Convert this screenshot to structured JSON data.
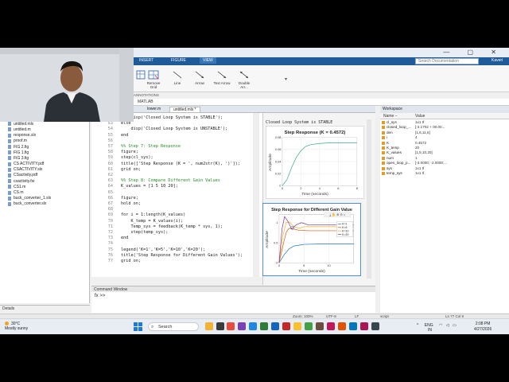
{
  "ribbon": {
    "tabs": [
      "INSERT",
      "FIGURE",
      "VIEW"
    ],
    "active_tab": "VIEW",
    "search_placeholder": "Search Documentation",
    "user": "Kaveri",
    "buttons": [
      "Remove Grid",
      "Line",
      "Arrow",
      "Text Arrow",
      "Double Arr..."
    ],
    "section_label": "ANNOTATIONS"
  },
  "address": "MATLAB",
  "files": {
    "items": [
      "untitled2.m",
      "untitled.mlx",
      "untitled.m",
      "response.slx",
      "proof.m",
      "FIG 2.fig",
      "FIG 1.fig",
      "FIG 3.fig",
      "CS ACTIVITY.pdf",
      "CSACTIVITY.slx",
      "CSactivity.pdf",
      "csactivity.fw",
      "CS1.m",
      "CS.m",
      "buck_converter_1.slx",
      "buck_converter.slx"
    ],
    "details_label": "Details"
  },
  "editor": {
    "tabs": [
      "lower.m",
      "untitled.mlx *"
    ],
    "lines": [
      {
        "n": "52",
        "t": "    disp('Closed Loop System is STABLE');",
        "c": false
      },
      {
        "n": "53",
        "t": "else",
        "c": false
      },
      {
        "n": "54",
        "t": "    disp('Closed Loop System is UNSTABLE');",
        "c": false
      },
      {
        "n": "55",
        "t": "end",
        "c": false
      },
      {
        "n": "56",
        "t": "",
        "c": false
      },
      {
        "n": "57",
        "t": "%% Step 7: Step Response",
        "c": true
      },
      {
        "n": "58",
        "t": "figure;",
        "c": false
      },
      {
        "n": "59",
        "t": "step(cl_sys);",
        "c": false
      },
      {
        "n": "60",
        "t": "title(['Step Response (K = ', num2str(K), ')']);",
        "c": false
      },
      {
        "n": "61",
        "t": "grid on;",
        "c": false
      },
      {
        "n": "62",
        "t": "",
        "c": false
      },
      {
        "n": "63",
        "t": "%% Step 8: Compare Different Gain Values",
        "c": true
      },
      {
        "n": "64",
        "t": "K_values = [1 5 10 20];",
        "c": false
      },
      {
        "n": "65",
        "t": "",
        "c": false
      },
      {
        "n": "66",
        "t": "figure;",
        "c": false
      },
      {
        "n": "67",
        "t": "hold on;",
        "c": false
      },
      {
        "n": "68",
        "t": "",
        "c": false
      },
      {
        "n": "69",
        "t": "for i = 1:length(K_values)",
        "c": false
      },
      {
        "n": "70",
        "t": "    K_temp = K_values(i);",
        "c": false
      },
      {
        "n": "71",
        "t": "    Temp_sys = feedback(K_temp * sys, 1);",
        "c": false
      },
      {
        "n": "72",
        "t": "    step(temp_sys);",
        "c": false
      },
      {
        "n": "73",
        "t": "end",
        "c": false
      },
      {
        "n": "74",
        "t": "",
        "c": false
      },
      {
        "n": "75",
        "t": "legend('K=1','K=5','K=10','K=20');",
        "c": false
      },
      {
        "n": "76",
        "t": "title('Step Response for Different Gain Values');",
        "c": false
      },
      {
        "n": "77",
        "t": "grid on;",
        "c": false
      }
    ]
  },
  "figures": {
    "output_text": "Closed Loop System is STABLE",
    "fig1": {
      "title": "Step Response (K = 0.4572)",
      "xlabel": "Time (seconds)",
      "ylabel": "Amplitude"
    },
    "fig2": {
      "title": "Step Response for Different Gain Value",
      "xlabel": "Time (seconds)",
      "ylabel": "Amplitude",
      "legend": [
        "K=1",
        "K=5",
        "K=10",
        "K=20"
      ]
    }
  },
  "chart_data": [
    {
      "type": "line",
      "title": "Step Response (K = 0.4572)",
      "xlabel": "Time (seconds)",
      "ylabel": "Amplitude",
      "xlim": [
        0,
        8
      ],
      "ylim": [
        0,
        0.08
      ],
      "xticks": [
        0,
        2,
        4,
        6,
        8
      ],
      "yticks": [
        0,
        0.02,
        0.04,
        0.06,
        0.08
      ],
      "series": [
        {
          "color": "#3aa88a",
          "x": [
            0,
            0.5,
            1,
            1.5,
            2,
            2.5,
            3,
            4,
            5,
            6,
            7,
            8
          ],
          "y": [
            0,
            0.01,
            0.03,
            0.047,
            0.058,
            0.065,
            0.068,
            0.07,
            0.071,
            0.071,
            0.071,
            0.071
          ]
        }
      ],
      "grid": true
    },
    {
      "type": "line",
      "title": "Step Response for Different Gain Value",
      "xlabel": "Time (seconds)",
      "ylabel": "Amplitude",
      "xlim": [
        0,
        15
      ],
      "ylim": [
        0,
        1.2
      ],
      "xticks": [
        0,
        5,
        10
      ],
      "yticks": [
        0,
        0.5,
        1
      ],
      "legend_position": "top-right",
      "series": [
        {
          "name": "K=1",
          "color": "#1f77b4",
          "x": [
            0,
            1,
            2,
            3,
            5,
            8,
            12,
            15
          ],
          "y": [
            0,
            0.2,
            0.35,
            0.42,
            0.46,
            0.47,
            0.47,
            0.47
          ]
        },
        {
          "name": "K=5",
          "color": "#d95319",
          "x": [
            0,
            1,
            1.5,
            2,
            3,
            4,
            6,
            9,
            15
          ],
          "y": [
            0,
            0.55,
            0.78,
            0.86,
            0.84,
            0.81,
            0.8,
            0.8,
            0.8
          ]
        },
        {
          "name": "K=10",
          "color": "#edb120",
          "x": [
            0,
            0.8,
            1.4,
            2,
            3,
            4,
            5,
            7,
            10,
            15
          ],
          "y": [
            0,
            0.7,
            1.0,
            1.02,
            0.9,
            0.86,
            0.9,
            0.9,
            0.9,
            0.9
          ]
        },
        {
          "name": "K=20",
          "color": "#7e2f8e",
          "x": [
            0,
            0.6,
            1.1,
            1.7,
            2.5,
            3.5,
            4.5,
            6,
            8,
            12,
            15
          ],
          "y": [
            0,
            0.85,
            1.15,
            1.05,
            0.85,
            0.95,
            1.0,
            0.94,
            0.95,
            0.95,
            0.95
          ]
        }
      ],
      "grid": true
    }
  ],
  "command": {
    "header": "Command Window",
    "prompt": "fx >>"
  },
  "workspace": {
    "title": "Workspace",
    "col_name": "Name −",
    "col_value": "Value",
    "rows": [
      {
        "name": "cl_sys",
        "value": "1x1 tf"
      },
      {
        "name": "closed_loop_...",
        "value": "[-3.1702 + 00.00..."
      },
      {
        "name": "den",
        "value": "[1,6,11,6]"
      },
      {
        "name": "i",
        "value": "4"
      },
      {
        "name": "K",
        "value": "0.4572"
      },
      {
        "name": "K_temp",
        "value": "20"
      },
      {
        "name": "K_values",
        "value": "[1,5,10,20]"
      },
      {
        "name": "num",
        "value": "1"
      },
      {
        "name": "open_loop_p...",
        "value": "[-3.0000; -2.0000;..."
      },
      {
        "name": "sys",
        "value": "1x1 tf"
      },
      {
        "name": "temp_sys",
        "value": "1x1 tf"
      }
    ]
  },
  "status": {
    "zoom": "Zoom: 100%",
    "encoding": "UTF-8",
    "eol": "LF",
    "mode": "script",
    "pos": "Ln  77   Col  9"
  },
  "taskbar": {
    "temp": "30°C",
    "weather": "Mostly sunny",
    "search": "Search",
    "lang": "ENG",
    "region": "IN",
    "time": "2:08 PM",
    "date": "4/27/2026"
  }
}
